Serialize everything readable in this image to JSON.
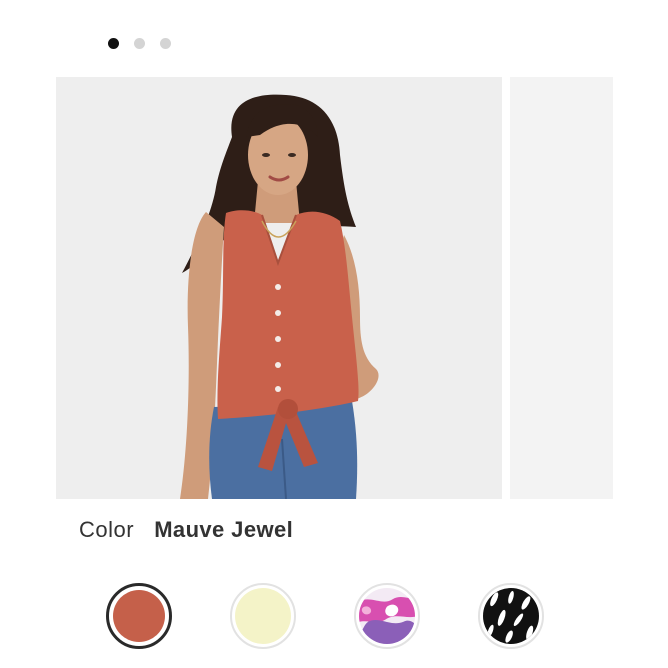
{
  "carousel": {
    "dot_count": 3,
    "active_index": 0,
    "main_image": "product-photo-woman-sleeveless-tie-front-blouse",
    "peek_image": "next-product-photo"
  },
  "color": {
    "label": "Color",
    "selected_name": "Mauve Jewel"
  },
  "swatches": [
    {
      "name": "mauve-jewel-swatch",
      "color": "#c5604a",
      "selected": true
    },
    {
      "name": "pale-yellow-swatch",
      "color": "#f4f3c8",
      "selected": false
    },
    {
      "name": "pink-abstract-print-swatch",
      "color": "#d84fb0",
      "selected": false
    },
    {
      "name": "black-white-print-swatch",
      "color": "#111111",
      "selected": false
    }
  ]
}
